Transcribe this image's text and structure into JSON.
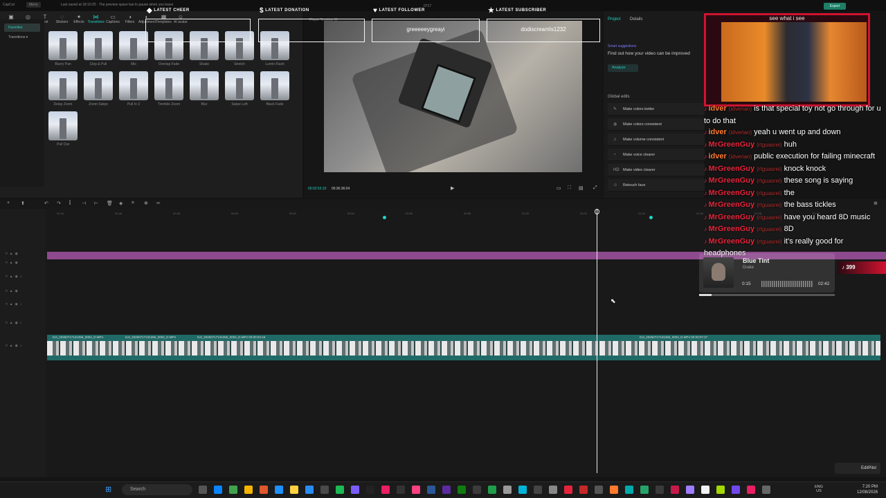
{
  "app": {
    "name": "CapCut",
    "menu_label": "Menu",
    "export_label": "Export",
    "topbar_text": "Last saved at 18:10:25 · The preview space bar to pause when you leave"
  },
  "toolbar_tabs": [
    {
      "label": "Media",
      "icon": "media-icon"
    },
    {
      "label": "Audio",
      "icon": "audio-icon"
    },
    {
      "label": "Text",
      "icon": "text-icon"
    },
    {
      "label": "Stickers",
      "icon": "stickers-icon"
    },
    {
      "label": "Effects",
      "icon": "effects-icon"
    },
    {
      "label": "Transitions",
      "icon": "transitions-icon",
      "active": true
    },
    {
      "label": "Captions",
      "icon": "captions-icon"
    },
    {
      "label": "Filters",
      "icon": "filters-icon"
    },
    {
      "label": "Adjustment",
      "icon": "adjustment-icon"
    },
    {
      "label": "Templates",
      "icon": "templates-icon"
    },
    {
      "label": "AI avatar",
      "icon": "ai-avatar-icon"
    }
  ],
  "side_categories": [
    {
      "label": "Favorites",
      "active": true
    },
    {
      "label": "Transitions ▾",
      "active": false
    }
  ],
  "transitions": [
    "Blurry Pan",
    "Clep & Pull",
    "Mix",
    "Overlap Fade",
    "Shake",
    "Stretch",
    "Lumin Flash",
    "Delay Zoom",
    "Zoom Swipe",
    "Pull In 3",
    "Tremble Zoom",
    "Blur",
    "Swipe Left",
    "Black Fade",
    "Pull Out"
  ],
  "preview": {
    "player_label": "Player Timeline 01",
    "current_time": "00:02:53:10",
    "total_time": "00:36:36:04",
    "frame_label": "0717"
  },
  "right_panel": {
    "tabs": [
      "Project",
      "Details"
    ],
    "smart_title": "Smart suggestions",
    "smart_desc": "Find out how your video can be improved",
    "analyze_label": "Analyze",
    "global_title": "Global edits",
    "global_edits": [
      {
        "label": "Make colors better",
        "icon": "wand-icon"
      },
      {
        "label": "Make colors consistent",
        "icon": "palette-icon"
      },
      {
        "label": "Make volume consistent",
        "icon": "volume-icon"
      },
      {
        "label": "Make voice clearer",
        "icon": "voice-icon"
      },
      {
        "label": "Make video clearer",
        "icon": "hd-icon"
      },
      {
        "label": "Retouch face",
        "icon": "face-icon"
      }
    ]
  },
  "overlays": [
    {
      "head": "LATEST CHEER",
      "icon": "◆",
      "value": ""
    },
    {
      "head": "LATEST DONATION",
      "icon": "$",
      "value": ""
    },
    {
      "head": "LATEST FOLLOWER",
      "icon": "♥",
      "value": "greeeeeygreayi"
    },
    {
      "head": "LATEST SUBSCRIBER",
      "icon": "★",
      "value": "dodiscreamIs1232"
    }
  ],
  "webcam": {
    "caption": "see what i see"
  },
  "chat": [
    {
      "user": "idver",
      "handle": "(idverian)",
      "msg": "is that special toy not go through for u to do that",
      "color": "#ff7a2e"
    },
    {
      "user": "idver",
      "handle": "(idverian)",
      "msg": "yeah u went up and down",
      "color": "#ff7a2e"
    },
    {
      "user": "MrGreenGuy",
      "handle": "(rtguasrei)",
      "msg": "huh",
      "color": "#e5243b"
    },
    {
      "user": "idver",
      "handle": "(idverian)",
      "msg": "public execution for failing minecraft",
      "color": "#ff7a2e"
    },
    {
      "user": "MrGreenGuy",
      "handle": "(rtguasrei)",
      "msg": "knock knock",
      "color": "#e5243b"
    },
    {
      "user": "MrGreenGuy",
      "handle": "(rtguasrei)",
      "msg": "these song is saying",
      "color": "#e5243b"
    },
    {
      "user": "MrGreenGuy",
      "handle": "(rtguasrei)",
      "msg": "the",
      "color": "#e5243b"
    },
    {
      "user": "MrGreenGuy",
      "handle": "(rtguasrei)",
      "msg": "the bass tickles",
      "color": "#e5243b"
    },
    {
      "user": "MrGreenGuy",
      "handle": "(rtguasrei)",
      "msg": "have you heard 8D music",
      "color": "#e5243b"
    },
    {
      "user": "MrGreenGuy",
      "handle": "(rtguasrei)",
      "msg": "8D",
      "color": "#e5243b"
    },
    {
      "user": "MrGreenGuy",
      "handle": "(rtguasrei)",
      "msg": "it's really good for headphones",
      "color": "#e5243b"
    }
  ],
  "music": {
    "title": "Blue Tint",
    "artist": "Drake",
    "elapsed": "0:15",
    "total": "02:42",
    "progress": 0.09
  },
  "tiktok_count": "399",
  "ruler_ticks": [
    "00:44",
    "00:46",
    "00:48",
    "00:50",
    "00:52",
    "00:54",
    "00:56",
    "00:58",
    "01:00",
    "01:02",
    "01:04",
    "01:06",
    "01:08",
    "01:10"
  ],
  "clip_segments": [
    "DJI_20260717131355_0004_D.MP4",
    "DJI_20260717131355_0004_D.MP4",
    "DJI_20260717131355_0004_D.MP4  00:00:04:19",
    "DJI_20260717131355_0004_D.MP4  00:00:07:27"
  ],
  "editpilot_label": "EditPilot",
  "taskbar": {
    "search_placeholder": "Search",
    "lang": "ENG",
    "region": "US",
    "time": "7:20 PM",
    "date": "12/08/2026"
  }
}
